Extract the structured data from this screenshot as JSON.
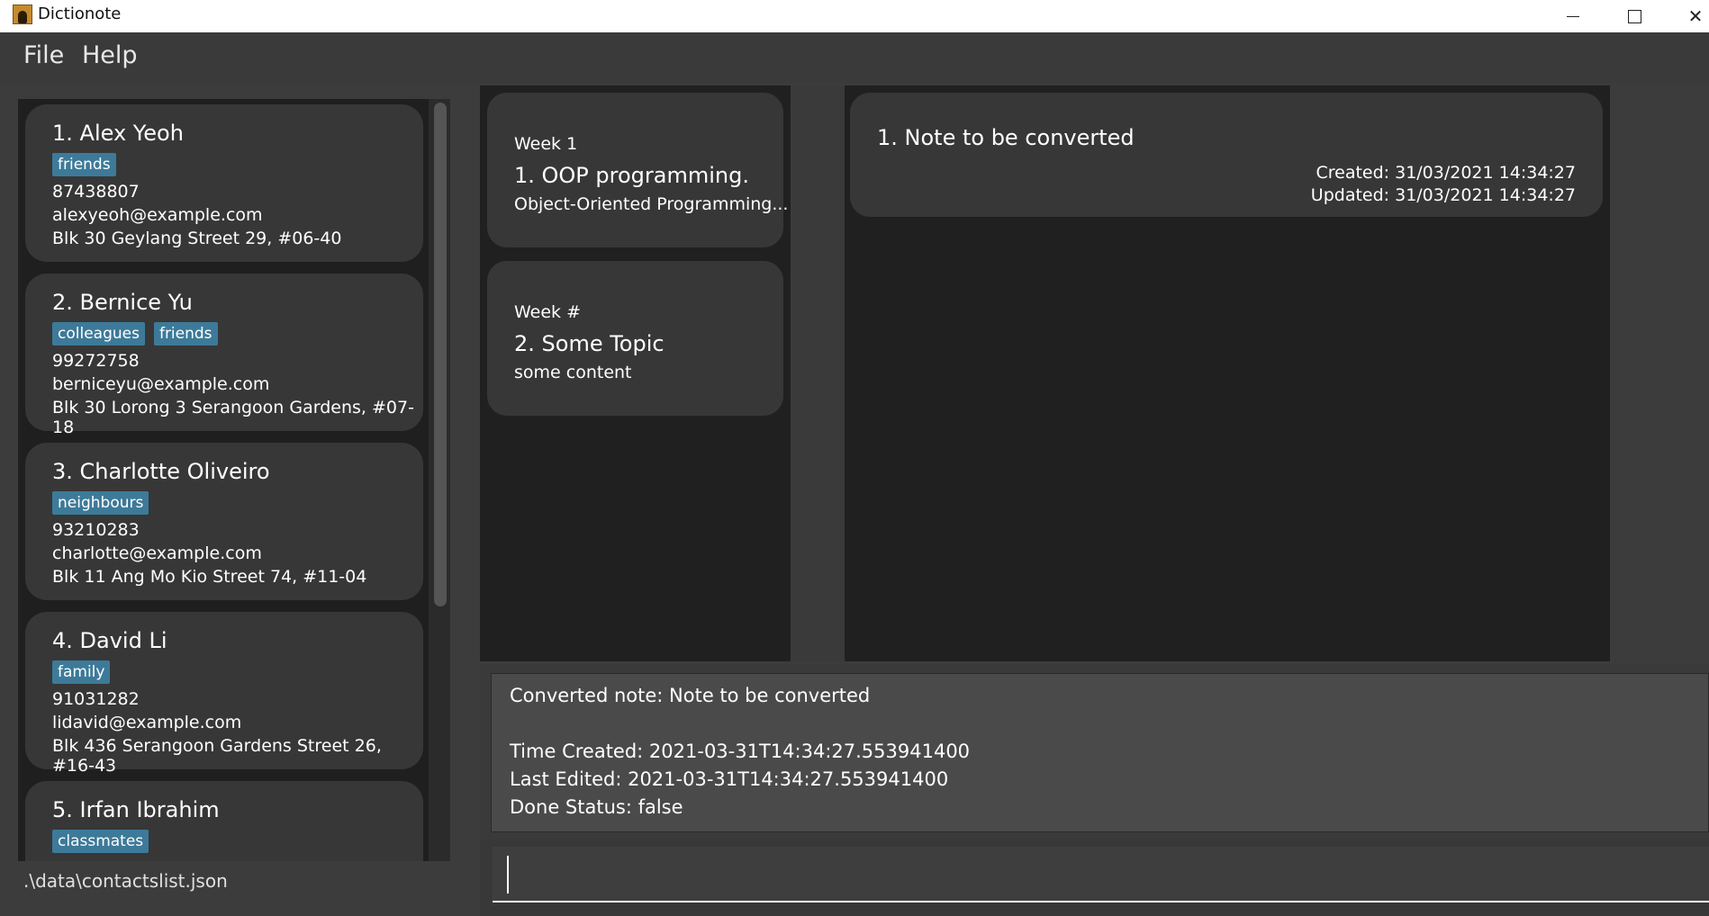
{
  "window": {
    "title": "Dictionote",
    "minimize": "–",
    "maximize": "☐",
    "close": "✕"
  },
  "menu": {
    "file": "File",
    "help": "Help"
  },
  "contacts": [
    {
      "name": "1.  Alex Yeoh",
      "tags": [
        "friends"
      ],
      "phone": "87438807",
      "email": "alexyeoh@example.com",
      "address": "Blk 30 Geylang Street 29, #06-40"
    },
    {
      "name": "2.  Bernice Yu",
      "tags": [
        "colleagues",
        "friends"
      ],
      "phone": "99272758",
      "email": "berniceyu@example.com",
      "address": "Blk 30 Lorong 3 Serangoon Gardens, #07-18"
    },
    {
      "name": "3.  Charlotte Oliveiro",
      "tags": [
        "neighbours"
      ],
      "phone": "93210283",
      "email": "charlotte@example.com",
      "address": "Blk 11 Ang Mo Kio Street 74, #11-04"
    },
    {
      "name": "4.  David Li",
      "tags": [
        "family"
      ],
      "phone": "91031282",
      "email": "lidavid@example.com",
      "address": "Blk 436 Serangoon Gardens Street 26, #16-43"
    },
    {
      "name": "5.  Irfan Ibrahim",
      "tags": [
        "classmates"
      ],
      "phone": "",
      "email": "",
      "address": ""
    }
  ],
  "status_bar": {
    "file_path": ".\\data\\contactslist.json"
  },
  "notes": [
    {
      "week": "Week 1",
      "title": "1.  OOP programming.",
      "content": "Object-Oriented Programming..."
    },
    {
      "week": "Week #",
      "title": "2.  Some Topic",
      "content": "some content"
    }
  ],
  "dictionary_note": {
    "title": "1.  Note to be converted",
    "created": "Created: 31/03/2021 14:34:27",
    "updated": "Updated: 31/03/2021 14:34:27"
  },
  "result": {
    "line1": "Converted note: Note to be converted",
    "line2": "Time Created: 2021-03-31T14:34:27.553941400",
    "line3": "Last Edited: 2021-03-31T14:34:27.553941400",
    "line4": "Done Status: false"
  },
  "command": {
    "value": ""
  },
  "colors": {
    "tag_bg": "#3d7a99",
    "card_bg": "#373737",
    "panel_bg": "#202020",
    "window_bg": "#3c3c3c"
  }
}
